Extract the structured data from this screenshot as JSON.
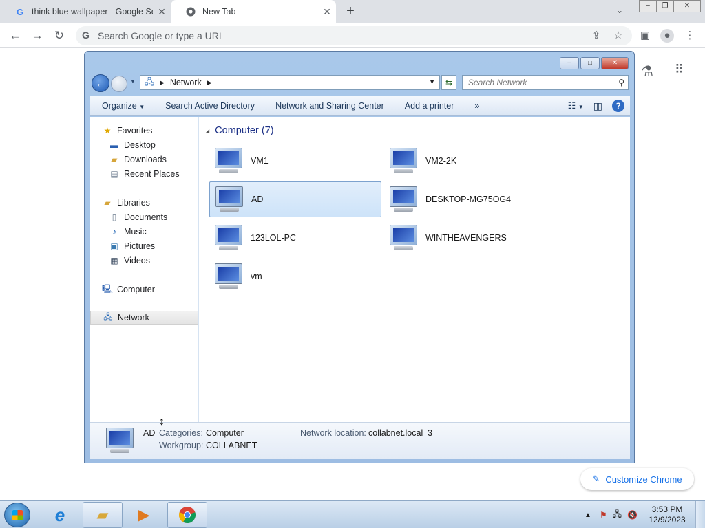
{
  "browser": {
    "tabs": [
      {
        "title": "think blue wallpaper - Google Se",
        "favicon": "G"
      },
      {
        "title": "New Tab",
        "favicon": "chrome-icon"
      }
    ],
    "new_tab_glyph": "+",
    "omnibox_placeholder": "Search Google or type a URL",
    "customize_label": "Customize Chrome"
  },
  "explorer": {
    "breadcrumb": [
      "Network"
    ],
    "search_placeholder": "Search Network",
    "commands": [
      "Organize",
      "Search Active Directory",
      "Network and Sharing Center",
      "Add a printer",
      "»"
    ],
    "nav": {
      "favorites": {
        "label": "Favorites",
        "items": [
          "Desktop",
          "Downloads",
          "Recent Places"
        ]
      },
      "libraries": {
        "label": "Libraries",
        "items": [
          "Documents",
          "Music",
          "Pictures",
          "Videos"
        ]
      },
      "computer": "Computer",
      "network": "Network"
    },
    "group_header": "Computer (7)",
    "computers": [
      {
        "name": "VM1"
      },
      {
        "name": "VM2-2K"
      },
      {
        "name": "AD",
        "selected": true
      },
      {
        "name": "DESKTOP-MG75OG4"
      },
      {
        "name": "123LOL-PC"
      },
      {
        "name": "WINTHEAVENGERS"
      },
      {
        "name": "vm"
      }
    ],
    "details": {
      "name": "AD",
      "categories_label": "Categories:",
      "categories_value": "Computer",
      "workgroup_label": "Workgroup:",
      "workgroup_value": "COLLABNET",
      "location_label": "Network location:",
      "location_value": "collabnet.local  3"
    }
  },
  "taskbar": {
    "time": "3:53 PM",
    "date": "12/9/2023"
  },
  "colors": {
    "accent": "#1a73e8",
    "explorer_frame": "#a9c8ea",
    "selection": "#cde3f9"
  }
}
